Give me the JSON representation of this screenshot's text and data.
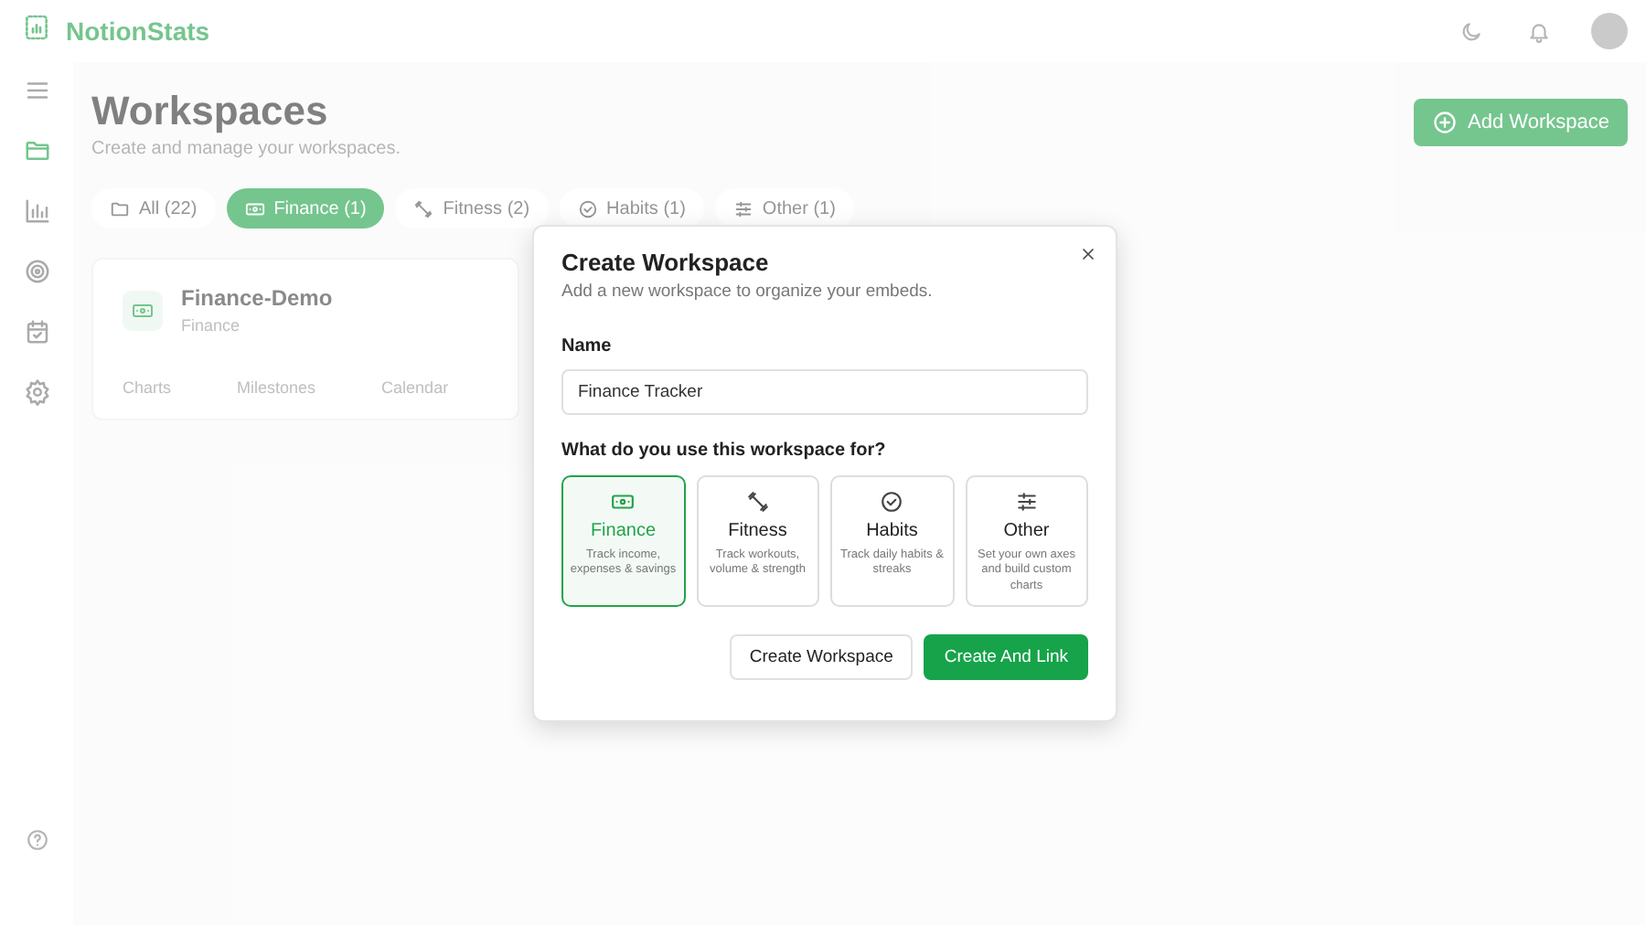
{
  "header": {
    "brand": "NotionStats"
  },
  "sidebar": {
    "items": [
      {
        "kind": "menu",
        "selected": false
      },
      {
        "kind": "folder",
        "selected": true
      },
      {
        "kind": "chart",
        "selected": false
      },
      {
        "kind": "target",
        "selected": false
      },
      {
        "kind": "calendar",
        "selected": false
      },
      {
        "kind": "settings",
        "selected": false
      }
    ]
  },
  "page": {
    "title": "Workspaces",
    "subtitle": "Create and manage your workspaces.",
    "add_button": "Add Workspace"
  },
  "filters": [
    {
      "kind": "all",
      "label": "All",
      "count": "(22)",
      "selected": false
    },
    {
      "kind": "finance",
      "label": "Finance",
      "count": "(1)",
      "selected": true
    },
    {
      "kind": "fitness",
      "label": "Fitness",
      "count": "(2)",
      "selected": false
    },
    {
      "kind": "habits",
      "label": "Habits",
      "count": "(1)",
      "selected": false
    },
    {
      "kind": "other",
      "label": "Other",
      "count": "(1)",
      "selected": false
    }
  ],
  "workspace_card": {
    "name": "Finance-Demo",
    "category": "Finance",
    "links": [
      "Charts",
      "Milestones",
      "Calendar"
    ]
  },
  "dialog": {
    "title": "Create Workspace",
    "subtitle": "Add a new workspace to organize your embeds.",
    "name_label": "Name",
    "name_value": "Finance Tracker",
    "question": "What do you use this workspace for?",
    "options": [
      {
        "kind": "finance",
        "label": "Finance",
        "description": "Track income, expenses & savings",
        "selected": true
      },
      {
        "kind": "fitness",
        "label": "Fitness",
        "description": "Track workouts, volume & strength",
        "selected": false
      },
      {
        "kind": "habits",
        "label": "Habits",
        "description": "Track daily habits & streaks",
        "selected": false
      },
      {
        "kind": "other",
        "label": "Other",
        "description": "Set your own axes and build custom charts",
        "selected": false
      }
    ],
    "buttons": [
      "Create Workspace",
      "Create And Link"
    ]
  }
}
